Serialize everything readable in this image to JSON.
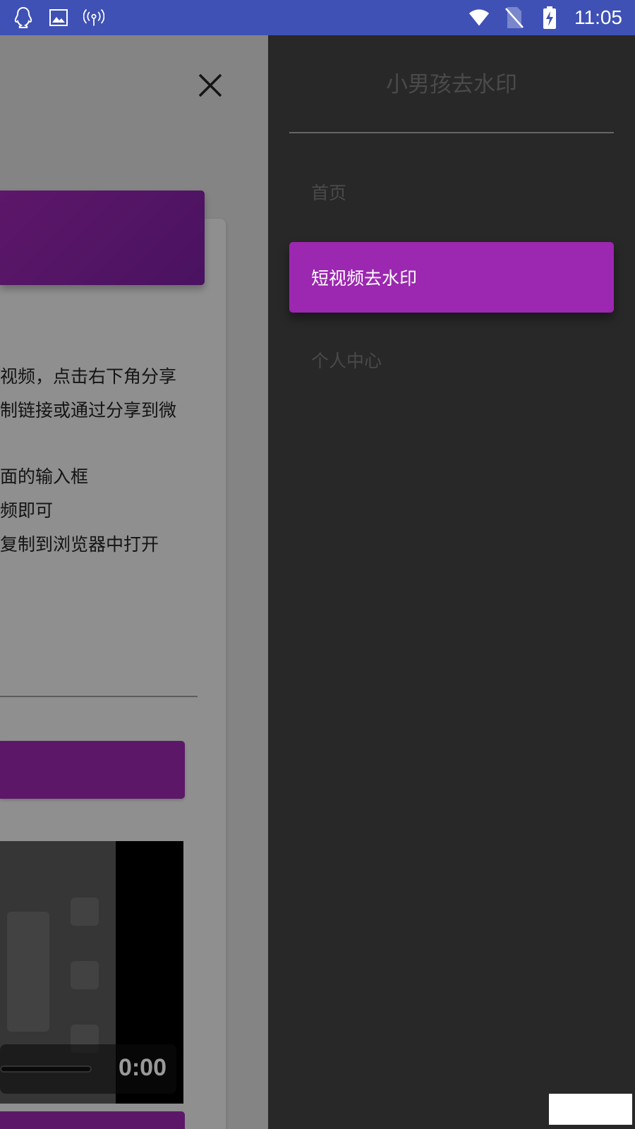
{
  "status_bar": {
    "time": "11:05",
    "left_icons": [
      "qq-icon",
      "image-icon",
      "hotspot-icon"
    ],
    "right_icons": [
      "wifi-icon",
      "no-sim-icon",
      "battery-charging-icon"
    ]
  },
  "drawer": {
    "title": "小男孩去水印",
    "items": [
      {
        "label": "首页",
        "active": false
      },
      {
        "label": "短视频去水印",
        "active": true
      },
      {
        "label": "个人中心",
        "active": false
      }
    ]
  },
  "page": {
    "instructions": [
      "视频，点击右下角分享",
      "制链接或通过分享到微",
      "面的输入框",
      "频即可",
      "复制到浏览器中打开"
    ],
    "video": {
      "time": "0:00"
    }
  },
  "colors": {
    "accent": "#9c27b0",
    "status_bar": "#3f51b5",
    "drawer_bg": "#282828"
  }
}
